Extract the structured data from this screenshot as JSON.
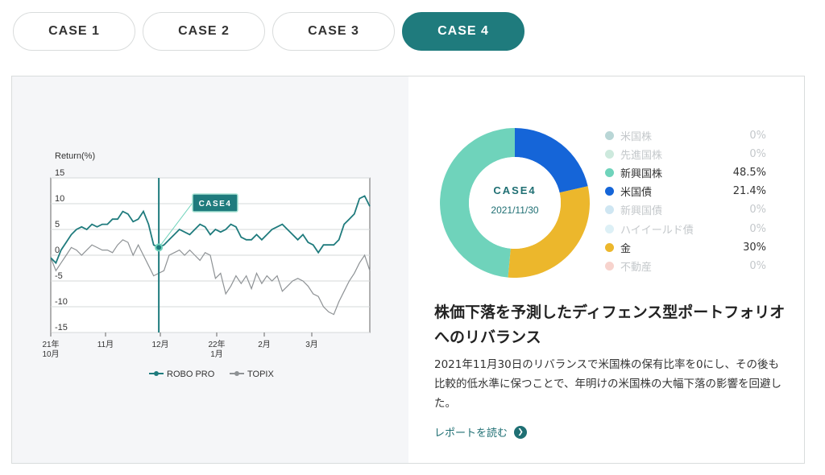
{
  "tabs": [
    {
      "label": "CASE 1",
      "active": false
    },
    {
      "label": "CASE 2",
      "active": false
    },
    {
      "label": "CASE 3",
      "active": false
    },
    {
      "label": "CASE 4",
      "active": true
    }
  ],
  "line_chart": {
    "ylabel": "Return(%)",
    "y_ticks": [
      "15",
      "10",
      "5",
      "0",
      "-5",
      "-10",
      "-15"
    ],
    "x_ticks": [
      {
        "l1": "21年",
        "l2": "10月"
      },
      {
        "l1": "11月",
        "l2": ""
      },
      {
        "l1": "12月",
        "l2": ""
      },
      {
        "l1": "22年",
        "l2": "1月"
      },
      {
        "l1": "2月",
        "l2": ""
      },
      {
        "l1": "3月",
        "l2": ""
      }
    ],
    "marker_label": "CASE4",
    "legend": [
      "ROBO PRO",
      "TOPIX"
    ],
    "colors": {
      "robo": "#1f7b7d",
      "topix": "#8e9295"
    }
  },
  "chart_data": [
    {
      "type": "line",
      "ylabel": "Return(%)",
      "ylim": [
        -15,
        15
      ],
      "x_ticks": [
        "21年10月",
        "11月",
        "12月",
        "22年1月",
        "2月",
        "3月"
      ],
      "series": [
        {
          "name": "ROBO PRO",
          "values": [
            -0.5,
            -1.5,
            1,
            2.5,
            4,
            5,
            5.5,
            5,
            6,
            5.5,
            6,
            6,
            7,
            7,
            8.5,
            8,
            6.5,
            7,
            8.5,
            6,
            2,
            1.5,
            2,
            3,
            4,
            5,
            4.5,
            4,
            5,
            6,
            5.5,
            4,
            5,
            4.5,
            5,
            6,
            5.5,
            3.5,
            3,
            3,
            4,
            3,
            4,
            5,
            5.5,
            6,
            5,
            4,
            3,
            4,
            2.5,
            2,
            0.5,
            2,
            2,
            2,
            3,
            6,
            7,
            8,
            11,
            11.5,
            9.5
          ]
        },
        {
          "name": "TOPIX",
          "values": [
            -0.5,
            -3,
            -1.5,
            0,
            1.5,
            1,
            0,
            1,
            2,
            1.5,
            1,
            1,
            0.5,
            2,
            3,
            2.5,
            0,
            2,
            0,
            -2,
            -4,
            -3.5,
            -3,
            0,
            0.5,
            1,
            0,
            1,
            0,
            -1,
            0.5,
            0,
            -4.5,
            -3.5,
            -7.5,
            -6,
            -4,
            -5.5,
            -4,
            -6.5,
            -3.5,
            -5.5,
            -4,
            -5,
            -4,
            -7,
            -6,
            -5,
            -4.5,
            -5,
            -6,
            -7.5,
            -8,
            -10,
            -11,
            -11.5,
            -9,
            -7,
            -5,
            -3.5,
            -1.5,
            0,
            -3
          ]
        }
      ],
      "annotation": "CASE4"
    },
    {
      "type": "pie",
      "categories": [
        "米国株",
        "先進国株",
        "新興国株",
        "米国債",
        "新興国債",
        "ハイイールド債",
        "金",
        "不動産"
      ],
      "values": [
        0,
        0,
        48.5,
        21.4,
        0,
        0,
        30,
        0
      ]
    }
  ],
  "donut": {
    "center_title": "CASE4",
    "center_date": "2021/11/30",
    "slices": [
      {
        "name": "米国債",
        "value": 21.4,
        "color": "#1565d8"
      },
      {
        "name": "金",
        "value": 30,
        "color": "#ecb72c"
      },
      {
        "name": "新興国株",
        "value": 48.5,
        "color": "#6fd3bb"
      }
    ]
  },
  "legend": [
    {
      "name": "米国株",
      "value": "0%",
      "color": "#b9d6d6",
      "dim": true
    },
    {
      "name": "先進国株",
      "value": "0%",
      "color": "#cde9dd",
      "dim": true
    },
    {
      "name": "新興国株",
      "value": "48.5%",
      "color": "#6fd3bb",
      "dim": false
    },
    {
      "name": "米国債",
      "value": "21.4%",
      "color": "#1565d8",
      "dim": false
    },
    {
      "name": "新興国債",
      "value": "0%",
      "color": "#cfe6f2",
      "dim": true
    },
    {
      "name": "ハイイールド債",
      "value": "0%",
      "color": "#ddf0f6",
      "dim": true
    },
    {
      "name": "金",
      "value": "30%",
      "color": "#ecb72c",
      "dim": false
    },
    {
      "name": "不動産",
      "value": "0%",
      "color": "#f7d3cd",
      "dim": true
    }
  ],
  "article": {
    "title": "株価下落を予測したディフェンス型ポートフォリオへのリバランス",
    "description": "2021年11月30日のリバランスで米国株の保有比率を0にし、その後も比較的低水準に保つことで、年明けの米国株の大幅下落の影響を回避した。",
    "link": "レポートを読む"
  }
}
